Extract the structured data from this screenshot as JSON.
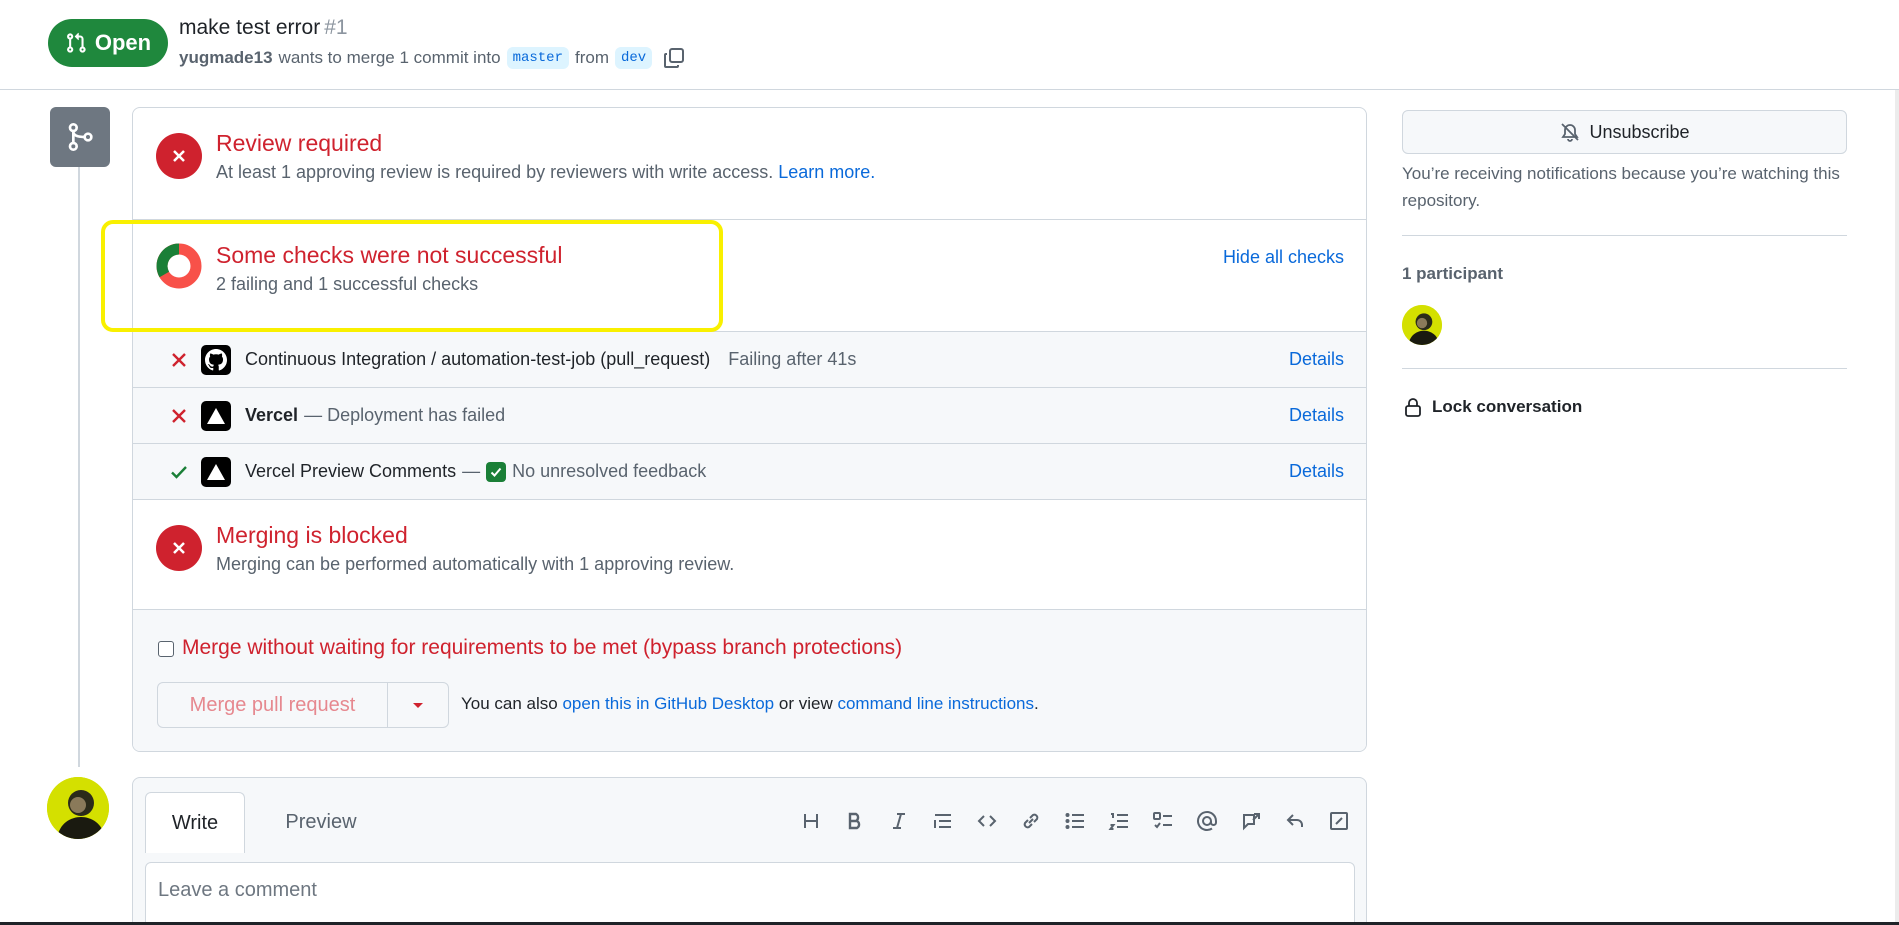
{
  "header": {
    "status_label": "Open",
    "title": "make test error",
    "number": "#1",
    "author": "yugmade13",
    "merge_text": "wants to merge 1 commit into",
    "base_branch": "master",
    "from_text": "from",
    "head_branch": "dev"
  },
  "mergebox": {
    "review": {
      "title": "Review required",
      "desc": "At least 1 approving review is required by reviewers with write access.",
      "link": "Learn more."
    },
    "checks": {
      "title": "Some checks were not successful",
      "desc": "2 failing and 1 successful checks",
      "toggle": "Hide all checks",
      "items": [
        {
          "status": "fail",
          "app": "github-icon",
          "name": "Continuous Integration / automation-test-job (pull_request)",
          "detail": "Failing after 41s",
          "link": "Details"
        },
        {
          "status": "fail",
          "app": "vercel-icon",
          "name": "Vercel",
          "detail": "— Deployment has failed",
          "link": "Details"
        },
        {
          "status": "success",
          "app": "vercel-icon",
          "name": "Vercel Preview Comments",
          "detail": "No unresolved feedback",
          "sep": "—",
          "link": "Details"
        }
      ]
    },
    "blocked": {
      "title": "Merging is blocked",
      "desc": "Merging can be performed automatically with 1 approving review."
    },
    "bypass_label": "Merge without waiting for requirements to be met (bypass branch protections)",
    "merge_button": "Merge pull request",
    "also_text_1": "You can also",
    "also_link_1": "open this in GitHub Desktop",
    "also_text_2": "or view",
    "also_link_2": "command line instructions",
    "also_text_3": "."
  },
  "composer": {
    "tab_write": "Write",
    "tab_preview": "Preview",
    "placeholder": "Leave a comment"
  },
  "sidebar": {
    "unsubscribe": "Unsubscribe",
    "notif_text": "You’re receiving notifications because you’re watching this repository.",
    "participants": "1 participant",
    "lock": "Lock conversation"
  },
  "colors": {
    "open_green": "#1f883d",
    "danger_red": "#cf222e",
    "link_blue": "#0969da",
    "highlight_yellow": "#f9f000"
  }
}
